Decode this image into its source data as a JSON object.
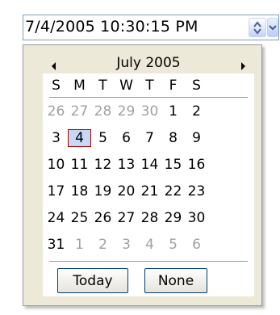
{
  "picker": {
    "value": "7/4/2005 10:30:15 PM",
    "spin_icon": "up-down-arrows-icon",
    "dropdown_icon": "chevron-down-icon"
  },
  "calendar": {
    "month_title": "July 2005",
    "prev_icon": "triangle-left-icon",
    "next_icon": "triangle-right-icon",
    "weekdays": [
      "S",
      "M",
      "T",
      "W",
      "T",
      "F",
      "S"
    ],
    "weeks": [
      [
        {
          "d": "26",
          "o": true
        },
        {
          "d": "27",
          "o": true
        },
        {
          "d": "28",
          "o": true
        },
        {
          "d": "29",
          "o": true
        },
        {
          "d": "30",
          "o": true
        },
        {
          "d": "1"
        },
        {
          "d": "2"
        }
      ],
      [
        {
          "d": "3"
        },
        {
          "d": "4",
          "t": true
        },
        {
          "d": "5"
        },
        {
          "d": "6"
        },
        {
          "d": "7"
        },
        {
          "d": "8"
        },
        {
          "d": "9"
        }
      ],
      [
        {
          "d": "10"
        },
        {
          "d": "11"
        },
        {
          "d": "12"
        },
        {
          "d": "13"
        },
        {
          "d": "14"
        },
        {
          "d": "15"
        },
        {
          "d": "16"
        }
      ],
      [
        {
          "d": "17"
        },
        {
          "d": "18"
        },
        {
          "d": "19"
        },
        {
          "d": "20"
        },
        {
          "d": "21"
        },
        {
          "d": "22"
        },
        {
          "d": "23"
        }
      ],
      [
        {
          "d": "24"
        },
        {
          "d": "25"
        },
        {
          "d": "26"
        },
        {
          "d": "27"
        },
        {
          "d": "28"
        },
        {
          "d": "29"
        },
        {
          "d": "30"
        }
      ],
      [
        {
          "d": "31"
        },
        {
          "d": "1",
          "o": true
        },
        {
          "d": "2",
          "o": true
        },
        {
          "d": "3",
          "o": true
        },
        {
          "d": "4",
          "o": true
        },
        {
          "d": "5",
          "o": true
        },
        {
          "d": "6",
          "o": true
        }
      ]
    ],
    "today_label": "Today",
    "none_label": "None"
  },
  "colors": {
    "field_border": "#7f9db9",
    "panel_bg": "#ece9d8",
    "selected_bg": "#c7d7f5",
    "selected_border": "#a00000",
    "other_month_text": "#a0a0a0",
    "arrow": "#4d6185"
  }
}
